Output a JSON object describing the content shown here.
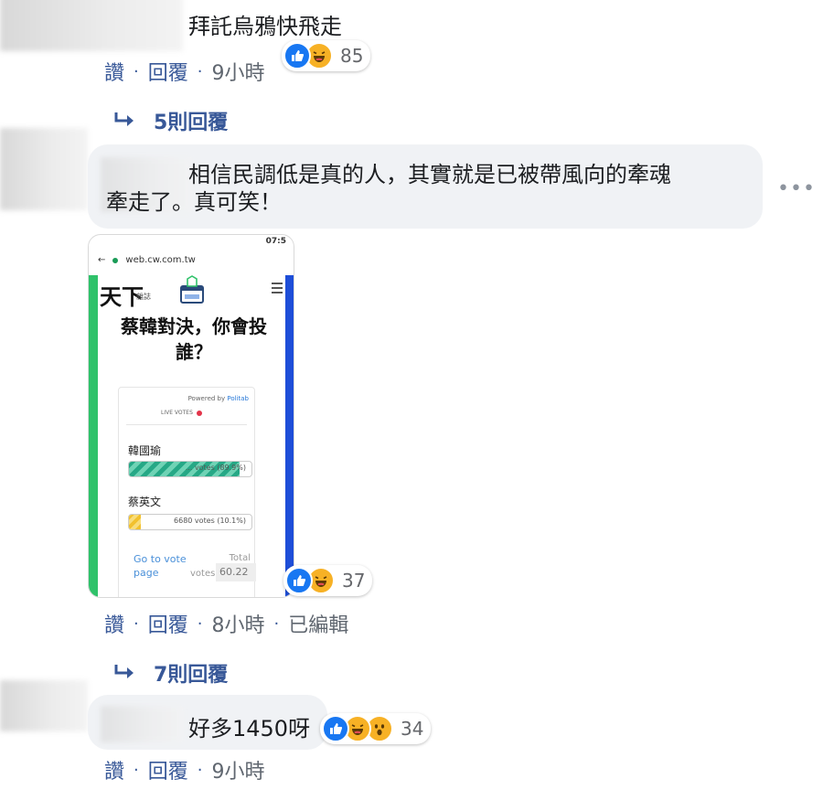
{
  "comments": [
    {
      "text": "拜託烏鴉快飛走",
      "reaction_count": "85",
      "actions": {
        "like": "讚",
        "reply": "回覆",
        "time": "9小時"
      },
      "replies_label": "5則回覆"
    },
    {
      "text_line1": "相信民調低是真的人，其實就是已被帶風向的牽魂",
      "text_line2": "牽走了。真可笑！",
      "reaction_count": "37",
      "actions": {
        "like": "讚",
        "reply": "回覆",
        "time": "8小時",
        "edited": "已編輯"
      },
      "replies_label": "7則回覆",
      "attachment": {
        "status_time": "07:5",
        "url": "web.cw.com.tw",
        "logo": "天下",
        "logo_sub": "雜誌",
        "headline": "蔡韓對決，你會投誰？",
        "powered_prefix": "Powered by",
        "powered_brand": "Politab",
        "live": "LIVE VOTES",
        "candidate1": "韓國瑜",
        "candidate1_votes": "... votes (89.9%)",
        "candidate1_share": 0.9,
        "candidate2": "蔡英文",
        "candidate2_votes": "6680 votes (10.1%)",
        "candidate2_share": 0.1,
        "goto": "Go to vote page",
        "total": "Total",
        "votes": "votes",
        "total_num": "60.22"
      }
    },
    {
      "text": "好多1450呀",
      "reaction_count": "34",
      "actions": {
        "like": "讚",
        "reply": "回覆",
        "time": "9小時"
      }
    }
  ],
  "more_label": "•••",
  "colors": {
    "link": "#385898",
    "bubble": "#f0f2f5",
    "like": "#1877f2",
    "haha": "#f7b125"
  },
  "icons": [
    "reply-arrow-icon",
    "like-reaction-icon",
    "haha-reaction-icon",
    "wow-reaction-icon",
    "more-options-icon"
  ]
}
